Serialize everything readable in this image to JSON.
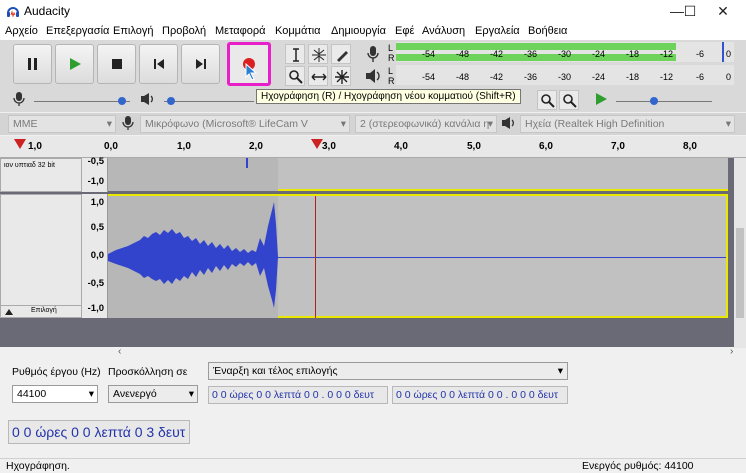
{
  "window": {
    "title": "Audacity",
    "minimize": "—",
    "maximize": "☐",
    "close": "✕"
  },
  "menu": [
    "Αρχείο",
    "Επεξεργασία",
    "Επιλογή",
    "Προβολή",
    "Μεταφορά",
    "Κομμάτια",
    "Δημιουργία",
    "Εφέ",
    "Ανάλυση",
    "Εργαλεία",
    "Βοήθεια"
  ],
  "meters": {
    "record_ticks": [
      "-54",
      "-48",
      "-42",
      "-36",
      "-30",
      "-24",
      "-18",
      "-12",
      "-6",
      "0"
    ],
    "play_ticks": [
      "-54",
      "-48",
      "-42",
      "-36",
      "-30",
      "-24",
      "-18",
      "-12",
      "-6",
      "0"
    ],
    "record_channels": [
      "L",
      "R"
    ],
    "play_channels": [
      "L",
      "R"
    ]
  },
  "tooltip": "Ηχογράφηση (R) / Ηχογράφηση νέου κομματιού (Shift+R)",
  "devices": {
    "host": "MME",
    "input": "Μικρόφωνο (Microsoft® LifeCam V",
    "channels": "2 (στερεοφωνικά) κανάλια η",
    "output": "Ηχεία (Realtek High Definition"
  },
  "ruler_ticks": [
    "1,0",
    "0,0",
    "1,0",
    "2,0",
    "3,0",
    "4,0",
    "5,0",
    "6,0",
    "7,0",
    "8,0"
  ],
  "track": {
    "info": "ιον υπτιαδ 32 bit",
    "select_label": "Επιλογή",
    "top_labels": [
      "-0,5",
      "-1,0"
    ],
    "bottom_labels": [
      "1,0",
      "0,5",
      "0,0",
      "-0,5",
      "-1,0"
    ]
  },
  "selection": {
    "rate_label": "Ρυθμός έργου (Hz)",
    "snap_label": "Προσκόλληση σε",
    "rate_value": "44100",
    "snap_value": "Ανενεργό",
    "mode_value": "Έναρξη και τέλος επιλογής",
    "start_time": "0 0 ώρες 0 0 λεπτά 0 0 . 0 0 0 δευτ",
    "end_time": "0 0 ώρες 0 0 λεπτά 0 0 . 0 0 0 δευτ"
  },
  "audio_position": "0 0 ώρες 0 0 λεπτά 0 3 δευτ",
  "status": {
    "left": "Ηχογράφηση.",
    "right": "Ενεργός ρυθμός: 44100"
  }
}
